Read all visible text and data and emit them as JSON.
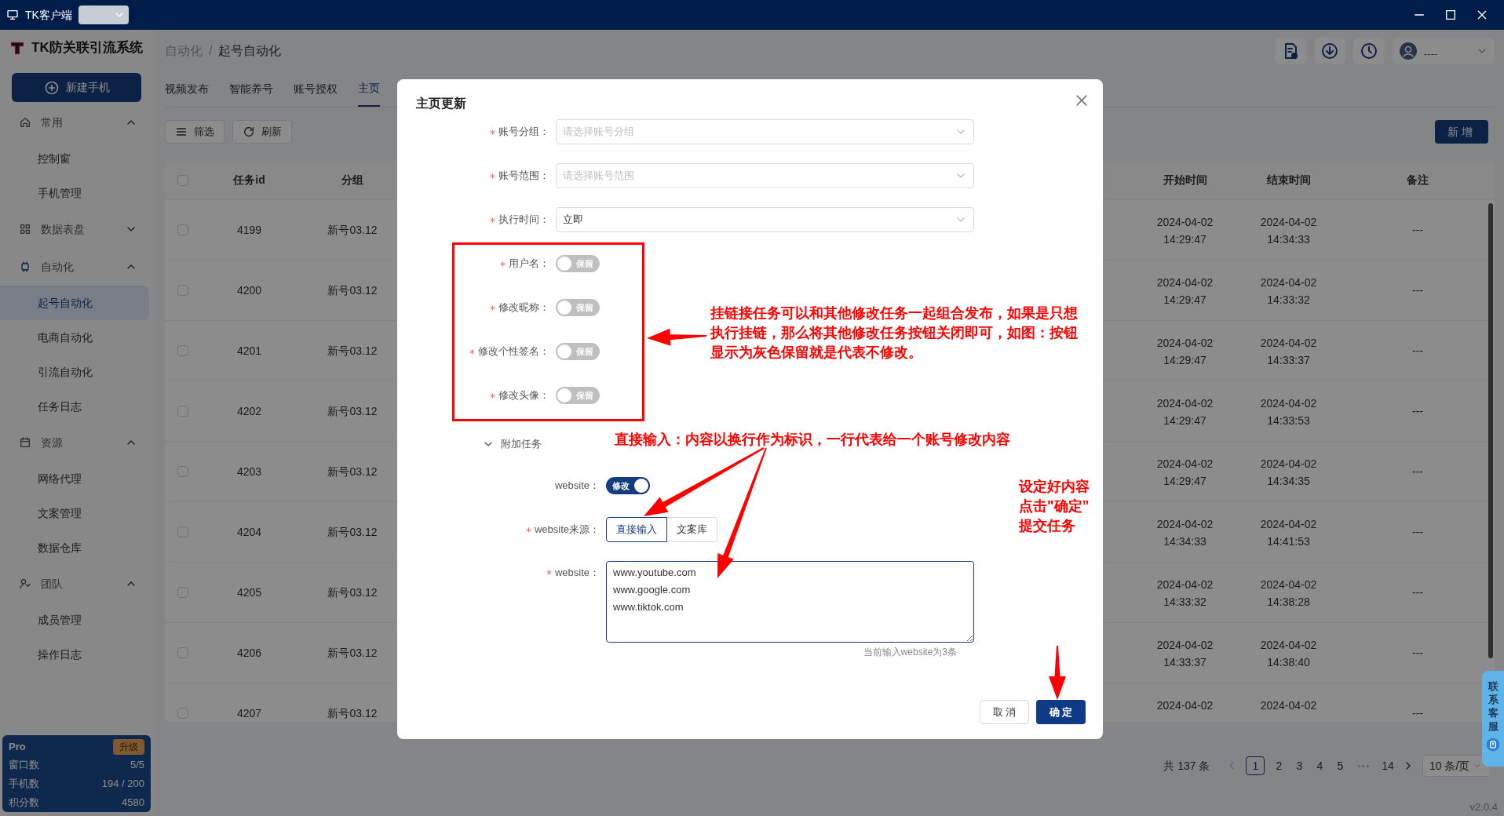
{
  "titlebar": {
    "title": "TK客户端"
  },
  "sidebar": {
    "logo": "TK防关联引流系统",
    "new_button": "新建手机",
    "groups": [
      {
        "label": "常用",
        "expanded": true,
        "items": [
          {
            "label": "控制窗",
            "selected": false
          },
          {
            "label": "手机管理",
            "selected": false
          }
        ]
      },
      {
        "label": "数据表盘",
        "expanded": false
      },
      {
        "label": "自动化",
        "expanded": true,
        "items": [
          {
            "label": "起号自动化",
            "selected": true
          },
          {
            "label": "电商自动化",
            "selected": false
          },
          {
            "label": "引流自动化",
            "selected": false
          },
          {
            "label": "任务日志",
            "selected": false
          }
        ]
      },
      {
        "label": "资源",
        "expanded": true,
        "items": [
          {
            "label": "网络代理",
            "selected": false
          },
          {
            "label": "文案管理",
            "selected": false
          },
          {
            "label": "数据仓库",
            "selected": false
          }
        ]
      },
      {
        "label": "团队",
        "expanded": true,
        "items": [
          {
            "label": "成员管理",
            "selected": false
          },
          {
            "label": "操作日志",
            "selected": false
          }
        ]
      }
    ],
    "plan": {
      "name": "Pro",
      "upgrade": "升级",
      "stats": [
        {
          "label": "窗口数",
          "value": "5/5"
        },
        {
          "label": "手机数",
          "value": "194 / 200"
        },
        {
          "label": "积分数",
          "value": "4580"
        }
      ]
    }
  },
  "header": {
    "breadcrumb": [
      "自动化",
      "起号自动化"
    ],
    "separator": "/",
    "user": "----"
  },
  "tabs": [
    {
      "label": "视频发布",
      "selected": false
    },
    {
      "label": "智能养号",
      "selected": false
    },
    {
      "label": "账号授权",
      "selected": false
    },
    {
      "label": "主页",
      "selected": true
    }
  ],
  "toolbar": {
    "filter": "筛选",
    "refresh": "刷新",
    "add": "新增"
  },
  "table": {
    "all_checked": false,
    "columns": [
      "任务id",
      "分组",
      "开始时间",
      "结束时间",
      "备注"
    ],
    "rows": [
      {
        "checked": false,
        "cells": [
          "4199",
          "新号03.12",
          "2024-04-02\n14:29:47",
          "2024-04-02\n14:34:33",
          "---"
        ]
      },
      {
        "checked": false,
        "cells": [
          "4200",
          "新号03.12",
          "2024-04-02\n14:29:47",
          "2024-04-02\n14:33:32",
          "---"
        ]
      },
      {
        "checked": false,
        "cells": [
          "4201",
          "新号03.12",
          "2024-04-02\n14:29:47",
          "2024-04-02\n14:33:37",
          "---"
        ]
      },
      {
        "checked": false,
        "cells": [
          "4202",
          "新号03.12",
          "2024-04-02\n14:29:47",
          "2024-04-02\n14:33:53",
          "---"
        ]
      },
      {
        "checked": false,
        "cells": [
          "4203",
          "新号03.12",
          "2024-04-02\n14:29:47",
          "2024-04-02\n14:34:35",
          "---"
        ]
      },
      {
        "checked": false,
        "cells": [
          "4204",
          "新号03.12",
          "2024-04-02\n14:34:33",
          "2024-04-02\n14:41:53",
          "---"
        ]
      },
      {
        "checked": false,
        "cells": [
          "4205",
          "新号03.12",
          "2024-04-02\n14:33:32",
          "2024-04-02\n14:38:28",
          "---"
        ]
      },
      {
        "checked": false,
        "cells": [
          "4206",
          "新号03.12",
          "2024-04-02\n14:33:37",
          "2024-04-02\n14:38:40",
          "---"
        ]
      },
      {
        "checked": false,
        "cells": [
          "4207",
          "新号03.12",
          "2024-04-02",
          "2024-04-02",
          "---"
        ]
      }
    ]
  },
  "pagination": {
    "total": "共 137 条",
    "pages": [
      {
        "label": "1",
        "selected": true
      },
      {
        "label": "2",
        "selected": false
      },
      {
        "label": "3",
        "selected": false
      },
      {
        "label": "4",
        "selected": false
      },
      {
        "label": "5",
        "selected": false
      },
      {
        "label": "•••",
        "kind": "ellipsis"
      },
      {
        "label": "14",
        "selected": false
      }
    ],
    "page_size": "10 条/页"
  },
  "version": "v2.0.4",
  "support": "联系客服",
  "modal": {
    "title": "主页更新",
    "fields": [
      {
        "kind": "select",
        "label": "账号分组：",
        "required": true,
        "placeholder": "请选择账号分组"
      },
      {
        "kind": "select",
        "label": "账号范围：",
        "required": true,
        "placeholder": "请选择账号范围"
      },
      {
        "kind": "select",
        "label": "执行时间：",
        "required": true,
        "value": "立即"
      },
      {
        "kind": "switch",
        "label": "用户名：",
        "required": true,
        "on": false,
        "text": "保留"
      },
      {
        "kind": "switch",
        "label": "修改昵称：",
        "required": true,
        "on": false,
        "text": "保留"
      },
      {
        "kind": "switch",
        "label": "修改个性签名：",
        "required": true,
        "on": false,
        "text": "保留"
      },
      {
        "kind": "switch",
        "label": "修改头像：",
        "required": true,
        "on": false,
        "text": "保留"
      }
    ],
    "section": {
      "label": "附加任务",
      "expanded": true,
      "fields": [
        {
          "kind": "switch",
          "label": "website：",
          "on": true,
          "text": "修改"
        },
        {
          "kind": "segmented",
          "label": "website来源：",
          "required": true,
          "options": [
            {
              "label": "直接输入",
              "selected": true
            },
            {
              "label": "文案库",
              "selected": false
            }
          ]
        },
        {
          "kind": "textarea",
          "label": "website：",
          "required": true,
          "value": "www.youtube.com\nwww.google.com\nwww.tiktok.com",
          "hint": "当前输入website为3条"
        }
      ]
    },
    "cancel": "取 消",
    "ok": "确 定"
  },
  "annotations": [
    {
      "kind": "paragraph",
      "text": "挂链接任务可以和其他修改任务一起组合发布，如果是只想执行挂链，那么将其他修改任务按钮关闭即可，如图：按钮显示为灰色保留就是代表不修改。"
    },
    {
      "kind": "line",
      "text": "直接输入：内容以换行作为标识，一行代表给一个账号修改内容"
    },
    {
      "kind": "lines",
      "lines": [
        "设定好内容",
        "点击\"确定”",
        "提交任务"
      ]
    }
  ]
}
